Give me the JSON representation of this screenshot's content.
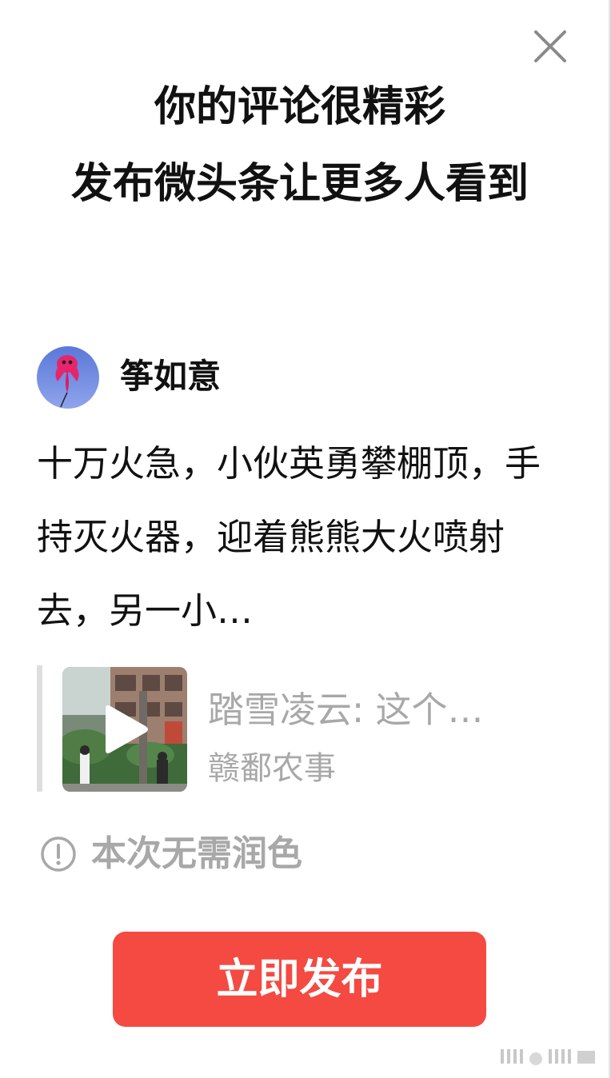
{
  "dialog": {
    "title_line1": "你的评论很精彩",
    "title_line2": "发布微头条让更多人看到"
  },
  "author": {
    "name": "筝如意",
    "avatar_icon": "kite-avatar-icon"
  },
  "post": {
    "text": "十万火急，小伙英勇攀棚顶，手持灭火器，迎着熊熊大火喷射去，另一小…"
  },
  "quote": {
    "title": "踏雪凌云: 这个…",
    "source": "赣鄱农事",
    "thumbnail_icon": "video-play-icon"
  },
  "notice": {
    "text": "本次无需润色",
    "icon": "info-circle-icon"
  },
  "actions": {
    "publish_label": "立即发布",
    "close_icon": "close-icon"
  },
  "colors": {
    "primary": "#f44a42",
    "muted_text": "#a8a8a8",
    "text": "#111111"
  }
}
